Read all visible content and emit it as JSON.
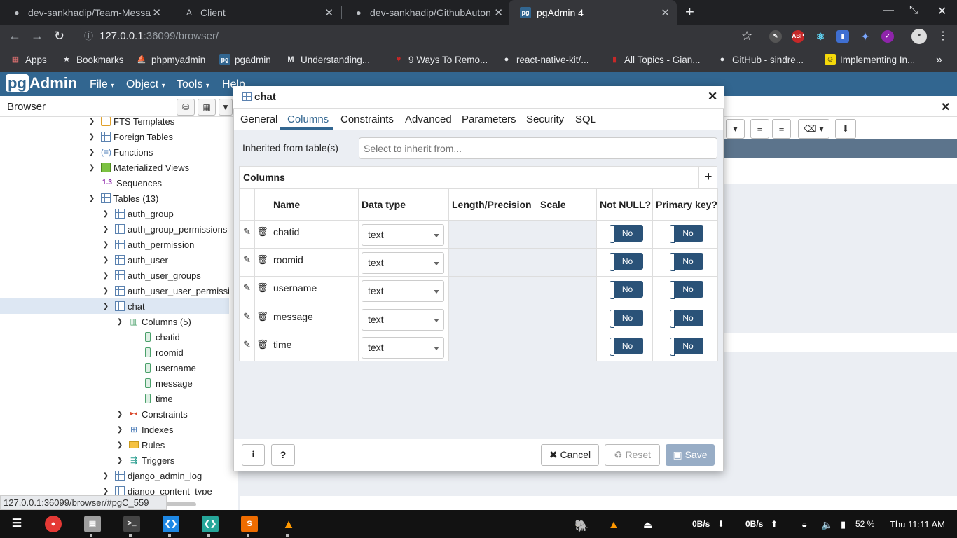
{
  "browser": {
    "tabs": [
      {
        "title": "dev-sankhadip/Team-Messa",
        "icon": "github-icon",
        "active": false
      },
      {
        "title": "Client",
        "icon": "react-icon",
        "active": false
      },
      {
        "title": "dev-sankhadip/GithubAuton",
        "icon": "github-icon",
        "active": false
      },
      {
        "title": "pgAdmin 4",
        "icon": "pgadmin-icon",
        "active": true
      }
    ],
    "url_host": "127.0.0.1",
    "url_path": ":36099/browser/",
    "bookmarks": [
      "Apps",
      "Bookmarks",
      "phpmyadmin",
      "pgadmin",
      "Understanding...",
      "9 Ways To Remo...",
      "react-native-kit/...",
      "All Topics - Gian...",
      "GitHub - sindre...",
      "Implementing In..."
    ],
    "ext_abp": "ABP",
    "status_url": "127.0.0.1:36099/browser/#pgC_559"
  },
  "pgadmin": {
    "logo_pg": "pg",
    "logo_rest": "Admin",
    "menu": [
      "File",
      "Object",
      "Tools",
      "Help"
    ],
    "browser_title": "Browser"
  },
  "tree": {
    "fts_templates": "FTS Templates",
    "foreign_tables": "Foreign Tables",
    "functions": "Functions",
    "mat_views": "Materialized Views",
    "seq_prefix": "1.3",
    "sequences": "Sequences",
    "tables": "Tables (13)",
    "table_items": [
      "auth_group",
      "auth_group_permissions",
      "auth_permission",
      "auth_user",
      "auth_user_groups",
      "auth_user_user_permissio"
    ],
    "chat": "chat",
    "columns": "Columns (5)",
    "column_items": [
      "chatid",
      "roomid",
      "username",
      "message",
      "time"
    ],
    "constraints": "Constraints",
    "indexes": "Indexes",
    "rules": "Rules",
    "triggers": "Triggers",
    "after_items": [
      "django_admin_log",
      "django_content_type"
    ]
  },
  "dialog": {
    "title": "chat",
    "tabs": [
      "General",
      "Columns",
      "Constraints",
      "Advanced",
      "Parameters",
      "Security",
      "SQL"
    ],
    "active_tab": "Columns",
    "inherited_label": "Inherited from table(s)",
    "inherited_placeholder": "Select to inherit from...",
    "columns_title": "Columns",
    "headers": [
      "Name",
      "Data type",
      "Length/Precision",
      "Scale",
      "Not NULL?",
      "Primary key?"
    ],
    "rows": [
      {
        "name": "chatid",
        "type": "text",
        "not_null": "No",
        "pk": "No"
      },
      {
        "name": "roomid",
        "type": "text",
        "not_null": "No",
        "pk": "No"
      },
      {
        "name": "username",
        "type": "text",
        "not_null": "No",
        "pk": "No"
      },
      {
        "name": "message",
        "type": "text",
        "not_null": "No",
        "pk": "No"
      },
      {
        "name": "time",
        "type": "text",
        "not_null": "No",
        "pk": "No"
      }
    ],
    "info_label": "i",
    "help_label": "?",
    "cancel_label": "Cancel",
    "reset_label": "Reset",
    "save_label": "Save"
  },
  "taskbar": {
    "net_down": "0B/s",
    "net_up": "0B/s",
    "battery": "52 %",
    "clock": "Thu 11:11 AM"
  },
  "colors": {
    "pgadmin_header": "#326690",
    "chrome_dark": "#202124",
    "toggle": "#2a5278",
    "save_disabled": "#98adc6"
  }
}
